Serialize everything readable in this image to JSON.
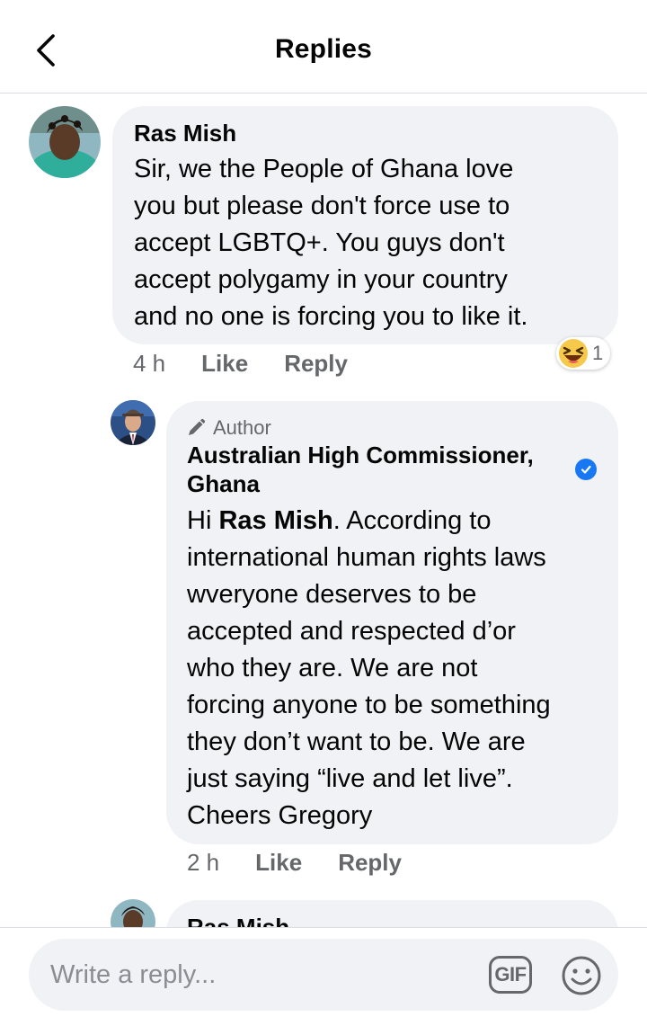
{
  "header": {
    "title": "Replies",
    "back_icon": "chevron-left-icon"
  },
  "comments": [
    {
      "author": "Ras Mish",
      "text": "Sir, we the People of Ghana love you but please don't force use to accept LGBTQ+. You guys don't accept polygamy in your country and no one is forcing you to like it.",
      "lines": [
        "Sir, we the People of Ghana love",
        "you but please don't force use to",
        "accept LGBTQ+. You guys don't",
        "accept polygamy in your country",
        "and no one is forcing you to like it."
      ],
      "time": "4 h",
      "like_label": "Like",
      "reply_label": "Reply",
      "reaction": {
        "icon": "laughing-emoji-icon",
        "count": "1"
      }
    },
    {
      "tag": "Author",
      "tag_icon": "pencil-icon",
      "author_lines": [
        "Australian High Commissioner,",
        "Ghana"
      ],
      "verified": true,
      "mention": "Ras Mish",
      "greeting": "Hi",
      "after_mention": ". According to",
      "lines": [
        "international human rights laws",
        "wveryone deserves to be",
        "accepted and respected d’or",
        "who they are. We are not",
        "forcing anyone to be something",
        "they don’t want to be. We are",
        "just saying “live and let live”.",
        "Cheers Gregory"
      ],
      "time": "2 h",
      "like_label": "Like",
      "reply_label": "Reply"
    },
    {
      "author": "Ras Mish"
    }
  ],
  "composer": {
    "placeholder": "Write a reply...",
    "gif_label": "GIF",
    "emoji_icon": "smiley-face-icon"
  },
  "colors": {
    "bubble": "#f0f2f5",
    "secondary_text": "#65676b",
    "verified_blue": "#1877f2"
  }
}
